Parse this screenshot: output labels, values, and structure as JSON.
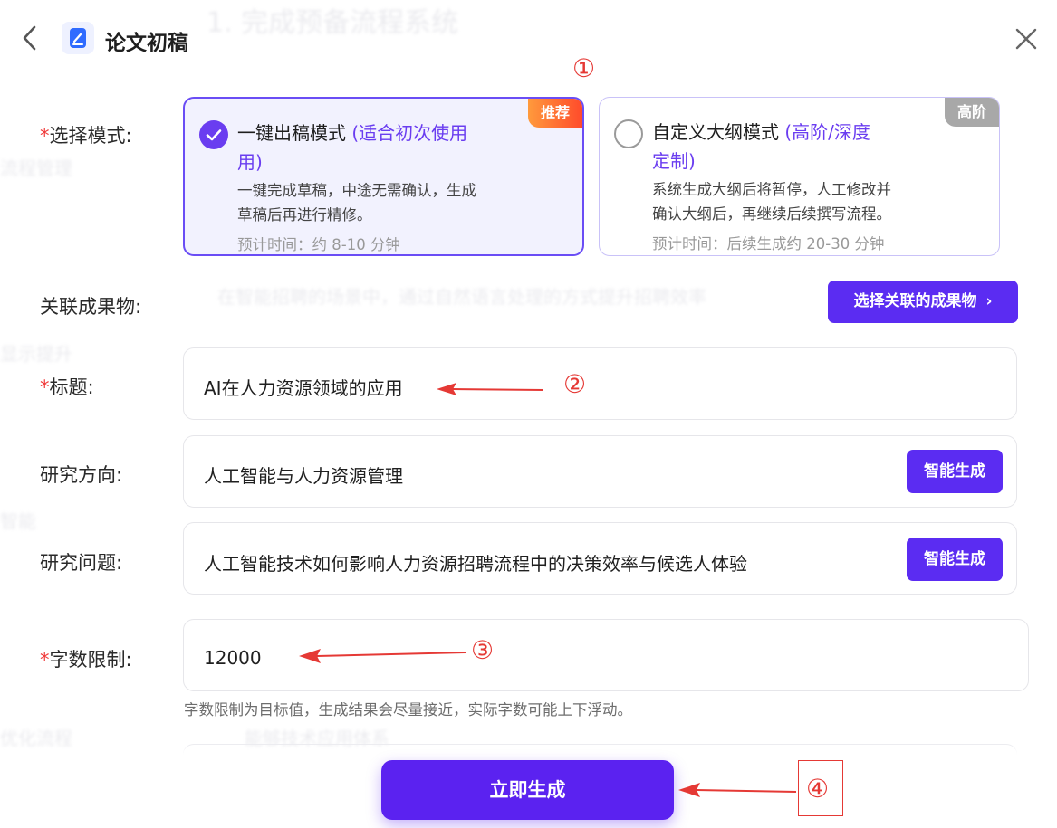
{
  "header": {
    "title": "论文初稿"
  },
  "form": {
    "mode": {
      "label": "选择模式:",
      "required_mark": "*",
      "options": [
        {
          "title": "一键出稿模式",
          "title_note": "(适合初次使用",
          "title_note_cont": "用)",
          "badge": "推荐",
          "desc_line1": "一键完成草稿，中途无需确认，生成",
          "desc_line2": "草稿后再进行精修。",
          "time": "预计时间：约 8-10 分钟",
          "selected": true
        },
        {
          "title": "自定义大纲模式",
          "title_note": "(高阶/深度",
          "title_note_cont": "定制)",
          "badge": "高阶",
          "desc_line1": "系统生成大纲后将暂停，人工修改并",
          "desc_line2": "确认大纲后，再继续后续撰写流程。",
          "time": "预计时间：后续生成约 20-30 分钟",
          "selected": false
        }
      ]
    },
    "related": {
      "label": "关联成果物:",
      "button_label": "选择关联的成果物",
      "button_chevron": "›"
    },
    "title_field": {
      "label": "标题:",
      "required_mark": "*",
      "value": "AI在人力资源领域的应用"
    },
    "direction": {
      "label": "研究方向:",
      "value": "人工智能与人力资源管理",
      "button_label": "智能生成"
    },
    "question": {
      "label": "研究问题:",
      "value": "人工智能技术如何影响人力资源招聘流程中的决策效率与候选人体验",
      "button_label": "智能生成"
    },
    "word_limit": {
      "label": "字数限制:",
      "required_mark": "*",
      "value": "12000",
      "hint": "字数限制为目标值，生成结果会尽量接近，实际字数可能上下浮动。"
    },
    "submit_label": "立即生成"
  },
  "annotations": {
    "marker_1": "①",
    "marker_2": "②",
    "marker_3": "③",
    "marker_4": "④",
    "color": "#e53935"
  },
  "colors": {
    "primary": "#5b2cf2",
    "required": "#f03a3a",
    "highlight": "#6a3df0",
    "badge_hot": "#ff5a2e",
    "badge_adv": "#a8a8a8"
  }
}
